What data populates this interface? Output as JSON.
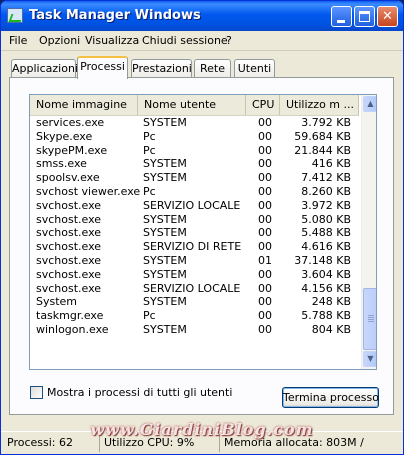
{
  "window": {
    "title": "Task Manager Windows"
  },
  "menu": [
    "File",
    "Opzioni",
    "Visualizza",
    "Chiudi sessione",
    "?"
  ],
  "tabs": [
    "Applicazioni",
    "Processi",
    "Prestazioni",
    "Rete",
    "Utenti"
  ],
  "active_tab": "Processi",
  "columns": [
    "Nome immagine",
    "Nome utente",
    "CPU",
    "Utilizzo m ..."
  ],
  "processes": [
    [
      "services.exe",
      "SYSTEM",
      "00",
      "3.792 KB"
    ],
    [
      "Skype.exe",
      "Pc",
      "00",
      "59.684 KB"
    ],
    [
      "skypePM.exe",
      "Pc",
      "00",
      "21.844 KB"
    ],
    [
      "smss.exe",
      "SYSTEM",
      "00",
      "416 KB"
    ],
    [
      "spoolsv.exe",
      "SYSTEM",
      "00",
      "7.412 KB"
    ],
    [
      "svchost viewer.exe",
      "Pc",
      "00",
      "8.260 KB"
    ],
    [
      "svchost.exe",
      "SERVIZIO LOCALE",
      "00",
      "3.972 KB"
    ],
    [
      "svchost.exe",
      "SYSTEM",
      "00",
      "5.080 KB"
    ],
    [
      "svchost.exe",
      "SYSTEM",
      "00",
      "5.488 KB"
    ],
    [
      "svchost.exe",
      "SERVIZIO DI RETE",
      "00",
      "4.616 KB"
    ],
    [
      "svchost.exe",
      "SYSTEM",
      "01",
      "37.148 KB"
    ],
    [
      "svchost.exe",
      "SYSTEM",
      "00",
      "3.604 KB"
    ],
    [
      "svchost.exe",
      "SERVIZIO LOCALE",
      "00",
      "4.156 KB"
    ],
    [
      "System",
      "SYSTEM",
      "00",
      "248 KB"
    ],
    [
      "taskmgr.exe",
      "Pc",
      "00",
      "5.788 KB"
    ],
    [
      "winlogon.exe",
      "SYSTEM",
      "00",
      "804 KB"
    ]
  ],
  "watermark": "www.GiardiniBlog.com",
  "show_all_checkbox": {
    "label": "Mostra i processi di tutti gli utenti",
    "checked": false
  },
  "end_process_button": "Termina processo",
  "status": {
    "processes": "Processi: 62",
    "cpu": "Utilizzo CPU: 9%",
    "memory": "Memoria allocata: 803M /"
  }
}
